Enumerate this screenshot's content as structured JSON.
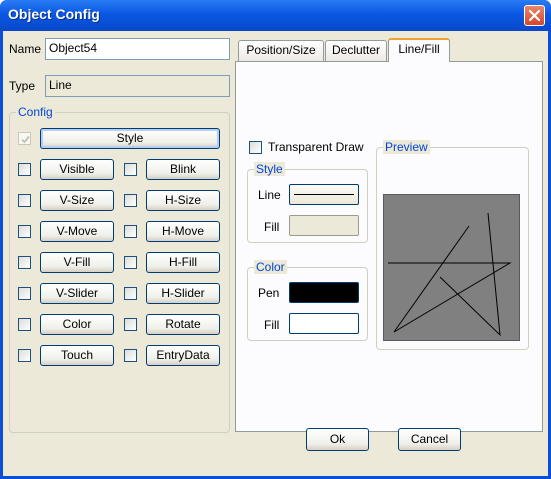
{
  "window": {
    "title": "Object Config"
  },
  "general": {
    "name_label": "Name",
    "name_value": "Object54",
    "type_label": "Type",
    "type_value": "Line"
  },
  "config": {
    "group_title": "Config",
    "style_button": "Style",
    "left_buttons": [
      "Visible",
      "V-Size",
      "V-Move",
      "V-Fill",
      "V-Slider",
      "Color",
      "Touch"
    ],
    "right_buttons": [
      "Blink",
      "H-Size",
      "H-Move",
      "H-Fill",
      "H-Slider",
      "Rotate",
      "EntryData"
    ]
  },
  "tabs": [
    {
      "label": "Position/Size",
      "active": false
    },
    {
      "label": "Declutter",
      "active": false
    },
    {
      "label": "Line/Fill",
      "active": true
    }
  ],
  "line_fill": {
    "transparent_draw_label": "Transparent Draw",
    "transparent_draw_checked": false,
    "style_group": "Style",
    "line_label": "Line",
    "fill_label": "Fill",
    "color_group": "Color",
    "pen_label": "Pen",
    "pen_color": "#000000",
    "color_fill_label": "Fill",
    "fill_color": "#ffffff",
    "preview_group": "Preview"
  },
  "actions": {
    "ok": "Ok",
    "cancel": "Cancel"
  },
  "colors": {
    "title_bar": "#0a58e3",
    "dialog_bg": "#ece9d8",
    "group_title": "#0046d5",
    "preview_bg": "#808080"
  }
}
